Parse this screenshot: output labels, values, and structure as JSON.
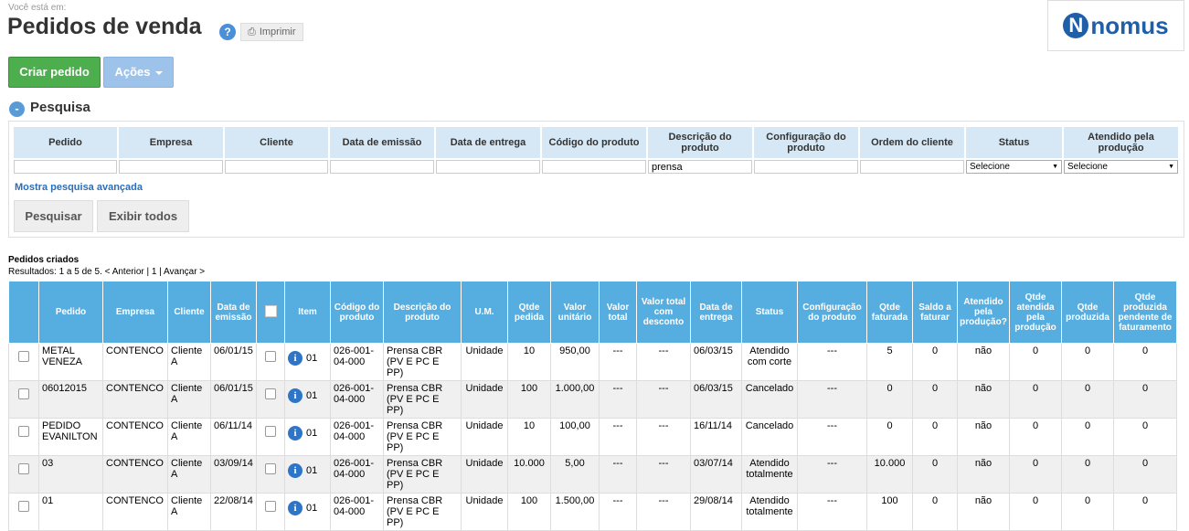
{
  "breadcrumb": "Você está em:",
  "page_title": "Pedidos de venda",
  "help_icon_text": "?",
  "print_label": "Imprimir",
  "logo": {
    "mark": "N",
    "text": "nomus"
  },
  "actions": {
    "create": "Criar pedido",
    "actions": "Ações"
  },
  "search": {
    "title": "Pesquisa",
    "toggle": "-",
    "headers": [
      "Pedido",
      "Empresa",
      "Cliente",
      "Data de emissão",
      "Data de entrega",
      "Código do produto",
      "Descrição do produto",
      "Configuração do produto",
      "Ordem do cliente",
      "Status",
      "Atendido pela produção"
    ],
    "values": [
      "",
      "",
      "",
      "",
      "",
      "",
      "prensa",
      "",
      ""
    ],
    "status_select": "Selecione",
    "atendido_select": "Selecione",
    "advanced_link": "Mostra pesquisa avançada",
    "search_button": "Pesquisar",
    "show_all_button": "Exibir todos"
  },
  "results": {
    "title": "Pedidos criados",
    "nav": "Resultados: 1 a 5 de 5. < Anterior | 1 | Avançar >",
    "columns": [
      "Pedido",
      "Empresa",
      "Cliente",
      "Data de emissão",
      "",
      "Item",
      "Código do produto",
      "Descrição do produto",
      "U.M.",
      "Qtde pedida",
      "Valor unitário",
      "Valor total",
      "Valor total com desconto",
      "Data de entrega",
      "Status",
      "Configuração do produto",
      "Qtde faturada",
      "Saldo a faturar",
      "Atendido pela produção?",
      "Qtde atendida pela produção",
      "Qtde produzida",
      "Qtde produzida pendente de faturamento"
    ],
    "rows": [
      {
        "pedido": "METAL VENEZA",
        "empresa": "CONTENCO",
        "cliente": "Cliente A",
        "emissao": "06/01/15",
        "item": "01",
        "codigo": "026-001-04-000",
        "descricao": "Prensa CBR (PV E PC E PP)",
        "um": "Unidade",
        "qtde": "10",
        "valor_unit": "950,00",
        "valor_total": "---",
        "valor_desc": "---",
        "entrega": "06/03/15",
        "status": "Atendido com corte",
        "config": "---",
        "faturada": "5",
        "saldo": "0",
        "atendido": "não",
        "qtde_atendida": "0",
        "produzida": "0",
        "pendente": "0"
      },
      {
        "pedido": "06012015",
        "empresa": "CONTENCO",
        "cliente": "Cliente A",
        "emissao": "06/01/15",
        "item": "01",
        "codigo": "026-001-04-000",
        "descricao": "Prensa CBR (PV E PC E PP)",
        "um": "Unidade",
        "qtde": "100",
        "valor_unit": "1.000,00",
        "valor_total": "---",
        "valor_desc": "---",
        "entrega": "06/03/15",
        "status": "Cancelado",
        "config": "---",
        "faturada": "0",
        "saldo": "0",
        "atendido": "não",
        "qtde_atendida": "0",
        "produzida": "0",
        "pendente": "0"
      },
      {
        "pedido": "PEDIDO EVANILTON",
        "empresa": "CONTENCO",
        "cliente": "Cliente A",
        "emissao": "06/11/14",
        "item": "01",
        "codigo": "026-001-04-000",
        "descricao": "Prensa CBR (PV E PC E PP)",
        "um": "Unidade",
        "qtde": "10",
        "valor_unit": "100,00",
        "valor_total": "---",
        "valor_desc": "---",
        "entrega": "16/11/14",
        "status": "Cancelado",
        "config": "---",
        "faturada": "0",
        "saldo": "0",
        "atendido": "não",
        "qtde_atendida": "0",
        "produzida": "0",
        "pendente": "0"
      },
      {
        "pedido": "03",
        "empresa": "CONTENCO",
        "cliente": "Cliente A",
        "emissao": "03/09/14",
        "item": "01",
        "codigo": "026-001-04-000",
        "descricao": "Prensa CBR (PV E PC E PP)",
        "um": "Unidade",
        "qtde": "10.000",
        "valor_unit": "5,00",
        "valor_total": "---",
        "valor_desc": "---",
        "entrega": "03/07/14",
        "status": "Atendido totalmente",
        "config": "---",
        "faturada": "10.000",
        "saldo": "0",
        "atendido": "não",
        "qtde_atendida": "0",
        "produzida": "0",
        "pendente": "0"
      },
      {
        "pedido": "01",
        "empresa": "CONTENCO",
        "cliente": "Cliente A",
        "emissao": "22/08/14",
        "item": "01",
        "codigo": "026-001-04-000",
        "descricao": "Prensa CBR (PV E PC E PP)",
        "um": "Unidade",
        "qtde": "100",
        "valor_unit": "1.500,00",
        "valor_total": "---",
        "valor_desc": "---",
        "entrega": "29/08/14",
        "status": "Atendido totalmente",
        "config": "---",
        "faturada": "100",
        "saldo": "0",
        "atendido": "não",
        "qtde_atendida": "0",
        "produzida": "0",
        "pendente": "0"
      }
    ]
  },
  "colors": {
    "header_blue": "#56aee0",
    "create_green": "#4cae4c",
    "actions_blue": "#9dc3ea",
    "search_header": "#d6e8f5",
    "logo_blue": "#1f5ea8"
  }
}
